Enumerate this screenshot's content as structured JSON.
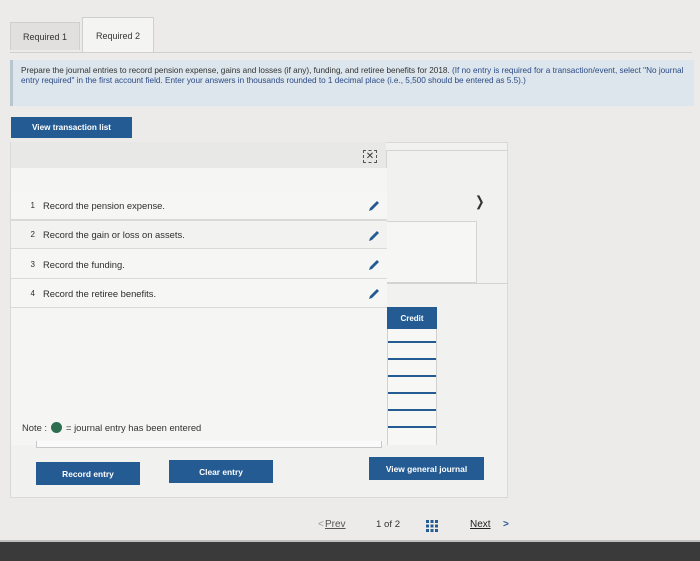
{
  "tabs": [
    {
      "label": "Required 1"
    },
    {
      "label": "Required 2"
    }
  ],
  "instructions": {
    "main": "Prepare the journal entries to record pension expense, gains and losses (if any), funding, and retiree benefits for 2018.",
    "hint": "(If no entry is required for a transaction/event, select \"No journal entry required\" in the first account field. Enter your answers in thousands rounded to 1 decimal place (i.e., 5,500 should be entered as 5.5).)"
  },
  "view_transaction_list_label": "View transaction list",
  "close_glyph": "✕",
  "transactions": [
    {
      "num": "1",
      "label": "Record the pension expense."
    },
    {
      "num": "2",
      "label": "Record the gain or loss on assets."
    },
    {
      "num": "3",
      "label": "Record the funding."
    },
    {
      "num": "4",
      "label": "Record the retiree benefits."
    }
  ],
  "credit_header": "Credit",
  "note": {
    "prefix": "Note :",
    "text": "= journal entry has been entered"
  },
  "buttons": {
    "record_entry": "Record entry",
    "clear_entry": "Clear entry",
    "view_general_journal": "View general journal"
  },
  "pager": {
    "prev": "Prev",
    "current": "1",
    "of": "of",
    "total": "2",
    "next": "Next"
  },
  "colors": {
    "accent_blue": "#245b93",
    "instruction_bg": "#dde6ec",
    "entered_dot": "#2c6e4f"
  }
}
